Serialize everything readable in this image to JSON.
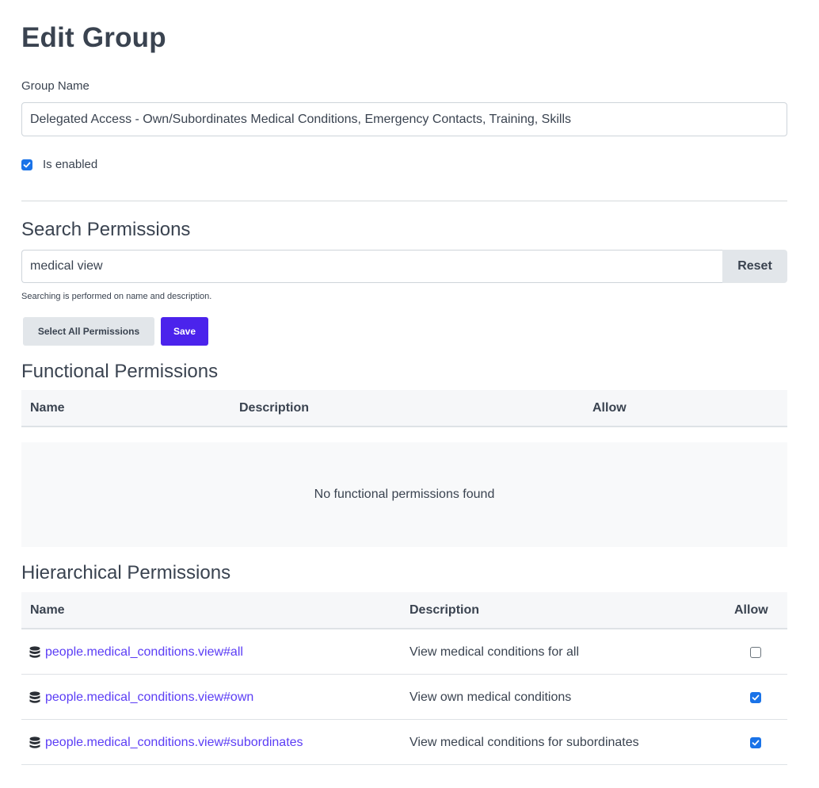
{
  "page": {
    "title": "Edit Group"
  },
  "group": {
    "name_label": "Group Name",
    "name_value": "Delegated Access - Own/Subordinates Medical Conditions, Emergency Contacts, Training, Skills",
    "enabled_label": "Is enabled",
    "enabled": true
  },
  "search": {
    "title": "Search Permissions",
    "value": "medical view",
    "reset_label": "Reset",
    "help": "Searching is performed on name and description."
  },
  "actions": {
    "select_all_label": "Select All Permissions",
    "save_label": "Save"
  },
  "functional": {
    "title": "Functional Permissions",
    "columns": [
      "Name",
      "Description",
      "Allow"
    ],
    "empty_message": "No functional permissions found"
  },
  "hierarchical": {
    "title": "Hierarchical Permissions",
    "columns": [
      "Name",
      "Description",
      "Allow"
    ],
    "rows": [
      {
        "name": "people.medical_conditions.view#all",
        "description": "View medical conditions for all",
        "allowed": false,
        "icon": "database-icon"
      },
      {
        "name": "people.medical_conditions.view#own",
        "description": "View own medical conditions",
        "allowed": true,
        "icon": "database-icon"
      },
      {
        "name": "people.medical_conditions.view#subordinates",
        "description": "View medical conditions for subordinates",
        "allowed": true,
        "icon": "database-icon"
      }
    ]
  },
  "colors": {
    "primary": "#4b23ec",
    "link": "#5b3df5",
    "checkbox": "#1a73e8",
    "text": "#3a4350"
  }
}
